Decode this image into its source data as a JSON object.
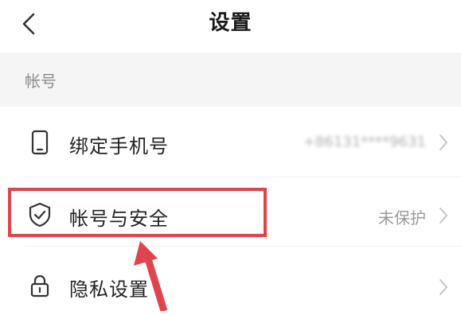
{
  "header": {
    "title": "设置",
    "back_icon": "chevron-left-icon"
  },
  "section": {
    "label": "帐号"
  },
  "rows": [
    {
      "label": "绑定手机号",
      "value": "+86131****9631",
      "icon": "phone-icon",
      "value_blurred": true
    },
    {
      "label": "帐号与安全",
      "value": "未保护",
      "icon": "shield-check-icon"
    },
    {
      "label": "隐私设置",
      "value": "",
      "icon": "lock-icon"
    }
  ],
  "annotation": {
    "highlight_color": "#e0444d",
    "arrow_color": "#e0444d"
  }
}
